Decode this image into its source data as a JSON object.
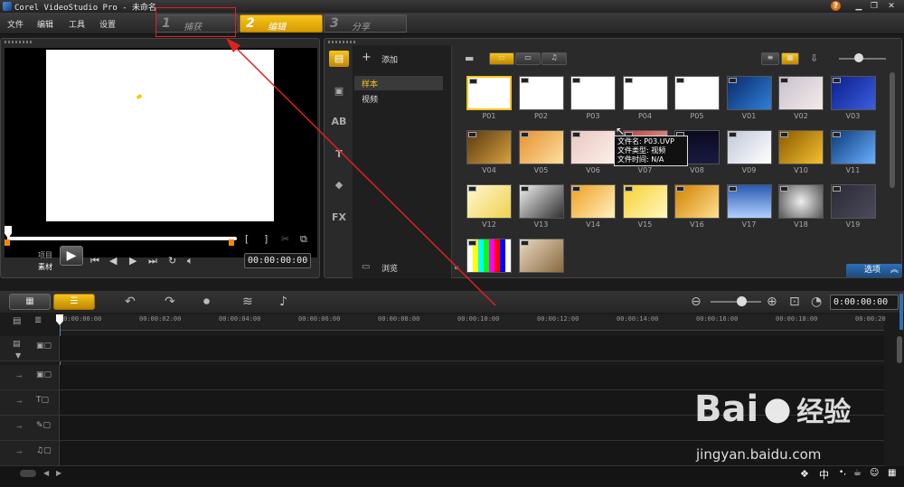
{
  "window": {
    "title": "Corel VideoStudio Pro - 未命名",
    "controls": [
      "help",
      "minimize",
      "restore",
      "close"
    ]
  },
  "menu": {
    "items": [
      "文件",
      "编辑",
      "工具",
      "设置"
    ]
  },
  "steps": [
    {
      "num": "1",
      "label": "捕获"
    },
    {
      "num": "2",
      "label": "编辑"
    },
    {
      "num": "3",
      "label": "分享"
    }
  ],
  "preview": {
    "mode_top": "项目",
    "mode_bottom": "素材",
    "timecode": "00:00:00:00",
    "mark_in": "[",
    "mark_out": "]"
  },
  "library": {
    "add_label": "添加",
    "folders": [
      "样本",
      "视频"
    ],
    "browse_label": "浏览",
    "options_label": "选项",
    "thumbnails": [
      {
        "label": "P01"
      },
      {
        "label": "P02"
      },
      {
        "label": "P03"
      },
      {
        "label": "P04"
      },
      {
        "label": "P05"
      },
      {
        "label": "V01"
      },
      {
        "label": "V02"
      },
      {
        "label": "V03"
      },
      {
        "label": "V04"
      },
      {
        "label": "V05"
      },
      {
        "label": "V06"
      },
      {
        "label": "V07"
      },
      {
        "label": "V08"
      },
      {
        "label": "V09"
      },
      {
        "label": "V10"
      },
      {
        "label": "V11"
      },
      {
        "label": "V12"
      },
      {
        "label": "V13"
      },
      {
        "label": "V14"
      },
      {
        "label": "V15"
      },
      {
        "label": "V16"
      },
      {
        "label": "V17"
      },
      {
        "label": "V18"
      },
      {
        "label": "V19"
      },
      {
        "label": ""
      },
      {
        "label": ""
      }
    ],
    "tooltip": {
      "line1": "文件名: P03.UVP",
      "line2": "文件类型: 视频",
      "line3": "文件时间: N/A"
    }
  },
  "timeline": {
    "timecode": "0:00:00:00",
    "ruler": [
      "00:00:00:00",
      "00:00:02:00",
      "00:00:04:00",
      "00:00:06:00",
      "00:00:08:00",
      "00:00:10:00",
      "00:00:12:00",
      "00:00:14:00",
      "00:00:16:00",
      "00:00:18:00",
      "00:00:20"
    ]
  },
  "watermark": {
    "brand": "Bai",
    "brand2": "经验",
    "url": "jingyan.baidu.com"
  },
  "statusbar": {
    "ime": "中"
  },
  "colors": {
    "accent": "#f5c51c",
    "highlight_box": "#e02020",
    "options_blue": "#2f6fb5"
  }
}
